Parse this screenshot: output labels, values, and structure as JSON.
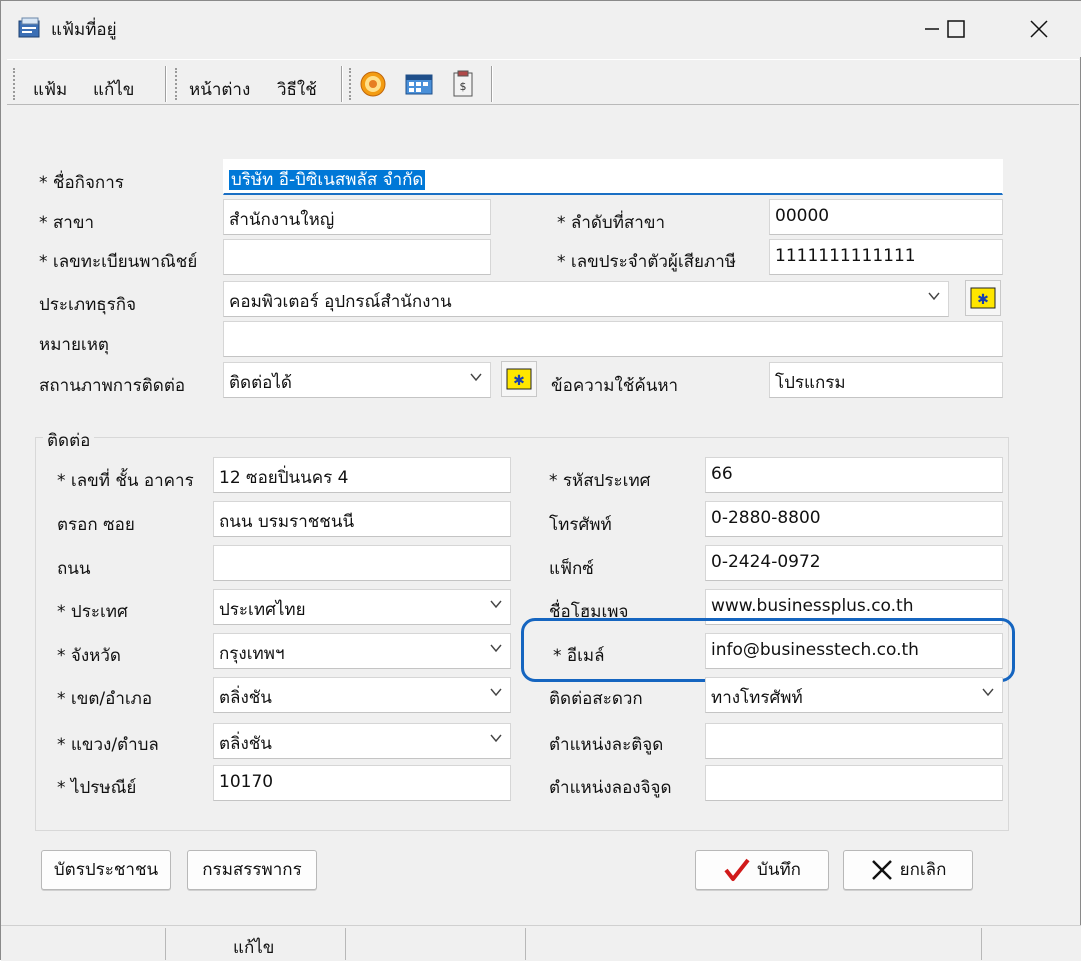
{
  "window": {
    "title": "แฟ้มที่อยู่",
    "minimize": "—",
    "maximize": "☐",
    "close": "✕"
  },
  "menu": {
    "items": [
      "แฟ้ม",
      "แก้ไข",
      "หน้าต่าง",
      "วิธีใช้"
    ]
  },
  "toolbar": {
    "icons": [
      "target-icon",
      "calendar-icon",
      "clipboard-icon"
    ]
  },
  "form": {
    "business_name": {
      "label": "* ชื่อกิจการ",
      "value": "บริษัท อี-บิซิเนสพลัส จำกัด"
    },
    "branch": {
      "label": "* สาขา",
      "value": "สำนักงานใหญ่"
    },
    "branch_no": {
      "label": "* ลำดับที่สาขา",
      "value": "00000"
    },
    "commerce_reg": {
      "label": "* เลขทะเบียนพาณิชย์",
      "value": ""
    },
    "tax_id": {
      "label": "* เลขประจำตัวผู้เสียภาษี",
      "value": "1111111111111"
    },
    "business_type": {
      "label": "ประเภทธุรกิจ",
      "value": "คอมพิวเตอร์ อุปกรณ์สำนักงาน"
    },
    "note": {
      "label": "หมายเหตุ",
      "value": ""
    },
    "contact_status": {
      "label": "สถานภาพการติดต่อ",
      "value": "ติดต่อได้"
    },
    "search_text": {
      "label": "ข้อความใช้ค้นหา",
      "value": "โปรแกรม"
    }
  },
  "contact": {
    "group_title": "ติดต่อ",
    "address_no": {
      "label": "* เลขที่ ชั้น อาคาร",
      "value": "12 ซอยปิ่นนคร 4"
    },
    "lane": {
      "label": "ตรอก ซอย",
      "value": "ถนน บรมราชชนนี"
    },
    "road": {
      "label": "ถนน",
      "value": ""
    },
    "country": {
      "label": "* ประเทศ",
      "value": "ประเทศไทย"
    },
    "province": {
      "label": "* จังหวัด",
      "value": "กรุงเทพฯ"
    },
    "district": {
      "label": "* เขต/อำเภอ",
      "value": "ตลิ่งชัน"
    },
    "subdistrict": {
      "label": "* แขวง/ตำบล",
      "value": "ตลิ่งชัน"
    },
    "postcode": {
      "label": "* ไปรษณีย์",
      "value": "10170"
    },
    "country_code": {
      "label": "* รหัสประเทศ",
      "value": "66"
    },
    "phone": {
      "label": "โทรศัพท์",
      "value": "0-2880-8800"
    },
    "fax": {
      "label": "แฟ็กซ์",
      "value": "0-2424-0972"
    },
    "homepage": {
      "label": "ชื่อโฮมเพจ",
      "value": "www.businessplus.co.th"
    },
    "email": {
      "label": "* อีเมล์",
      "value": "info@businesstech.co.th"
    },
    "preferred_contact": {
      "label": "ติดต่อสะดวก",
      "value": "ทางโทรศัพท์"
    },
    "latitude": {
      "label": "ตำแหน่งละติจูด",
      "value": ""
    },
    "longitude": {
      "label": "ตำแหน่งลองจิจูด",
      "value": ""
    }
  },
  "buttons": {
    "id_card": "บัตรประชาชน",
    "revenue": "กรมสรรพากร",
    "save": "บันทึก",
    "cancel": "ยกเลิก"
  },
  "status": {
    "mode": "แก้ไข"
  },
  "colors": {
    "highlight": "#1565c0",
    "selection": "#0078d7",
    "save_check": "#d11a1a"
  }
}
